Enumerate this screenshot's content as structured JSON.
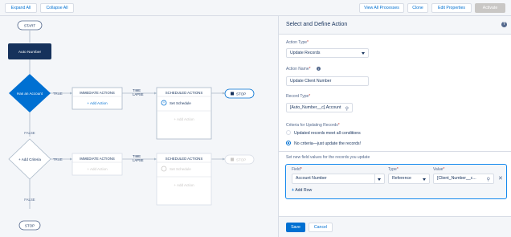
{
  "toolbar": {
    "expand_all": "Expand All",
    "collapse_all": "Collapse All",
    "view_all_processes": "View All Processes",
    "clone": "Clone",
    "edit_properties": "Edit Properties",
    "activate": "Activate"
  },
  "canvas": {
    "start": "START",
    "object_node": "Auto Number",
    "criteria_1": "Has an Account",
    "criteria_2_add": "+ Add Criteria",
    "true_label": "TRUE",
    "false_label": "FALSE",
    "immediate_actions": "IMMEDIATE ACTIONS",
    "time_lapse_1": "TIME",
    "time_lapse_2": "LAPSE",
    "scheduled_actions": "SCHEDULED ACTIONS",
    "add_action": "+ Add Action",
    "set_schedule": "Set Schedule",
    "stop": "STOP"
  },
  "panel": {
    "title": "Select and Define Action",
    "action_type_label": "Action Type",
    "action_type_value": "Update Records",
    "action_name_label": "Action Name",
    "action_name_value": "Update Client Number",
    "record_type_label": "Record Type",
    "record_type_value": "[Auto_Number__c].Account",
    "criteria_label": "Criteria for Updating Records",
    "option_conditions": "Updated records meet all conditions",
    "option_no_criteria": "No criteria—just update the records!",
    "set_values_label": "Set new field values for the records you update",
    "field_label": "Field",
    "type_label": "Type",
    "value_label": "Value",
    "field_value": "Account Number",
    "type_value": "Reference",
    "value_value": "[Client_Number__c...",
    "add_row": "Add Row",
    "save": "Save",
    "cancel": "Cancel",
    "required_mark": "*",
    "info_glyph": "i",
    "help_glyph": "?",
    "close_glyph": "✕",
    "search_glyph": "⚲",
    "plus_glyph": "+"
  },
  "colors": {
    "brand_blue": "#0070d2",
    "dark_node": "#16325c",
    "criteria_blue": "#0070d2"
  }
}
